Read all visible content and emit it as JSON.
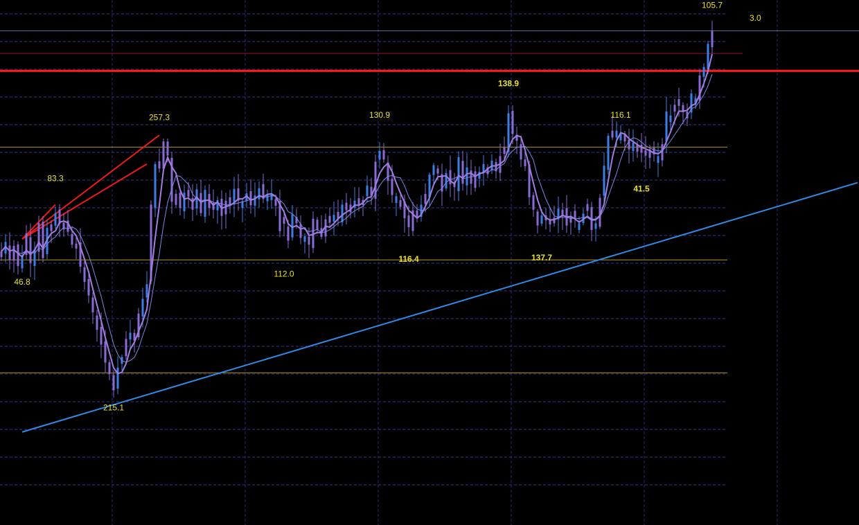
{
  "colors": {
    "background": "#000000",
    "grid_dash": "#3a3a9a",
    "grid_vertical": "#2a2a7a",
    "level_yellow": "#b8961e",
    "level_red_thick": "#ff1a1a",
    "level_maroon": "#8a1a2a",
    "level_steel": "#5a6a9a",
    "candle_blue": "#3b7fe6",
    "candle_violet": "#8a6ad6",
    "ma_short": "#a27ee0",
    "ma_long": "#7c8ae8",
    "trend_blue": "#2e8be8",
    "trend_red": "#ee1a1a",
    "label_yellow": "#e8e030"
  },
  "chart_data": {
    "type": "candlestick",
    "title": "",
    "xlabel": "",
    "ylabel": "",
    "bar_count": 175,
    "annotations": [
      {
        "text": "105.7",
        "bar": 171,
        "price": 105.7,
        "style": "normal",
        "pos": "above"
      },
      {
        "text": "3.0",
        "bar": 180,
        "price": 104.9,
        "style": "normal",
        "pos": "right"
      },
      {
        "text": "138.9",
        "bar": 122,
        "price": 91.8,
        "style": "bold",
        "pos": "above"
      },
      {
        "text": "257.3",
        "bar": 38,
        "price": 85.8,
        "style": "normal",
        "pos": "above"
      },
      {
        "text": "130.9",
        "bar": 91,
        "price": 86.2,
        "style": "normal",
        "pos": "above"
      },
      {
        "text": "116.1",
        "bar": 149,
        "price": 86.2,
        "style": "normal",
        "pos": "above"
      },
      {
        "text": "83.3",
        "bar": 13,
        "price": 75.0,
        "style": "normal",
        "pos": "above"
      },
      {
        "text": "41.5",
        "bar": 154,
        "price": 76.1,
        "style": "bold",
        "pos": "below"
      },
      {
        "text": "116.4",
        "bar": 98,
        "price": 63.6,
        "style": "bold",
        "pos": "below"
      },
      {
        "text": "137.7",
        "bar": 130,
        "price": 63.9,
        "style": "bold",
        "pos": "below"
      },
      {
        "text": "112.0",
        "bar": 68,
        "price": 61.0,
        "style": "normal",
        "pos": "below"
      },
      {
        "text": "46.8",
        "bar": 5,
        "price": 59.6,
        "style": "normal",
        "pos": "below"
      },
      {
        "text": "215.1",
        "bar": 27,
        "price": 37.3,
        "style": "normal",
        "pos": "below"
      }
    ],
    "levels": [
      {
        "name": "steel",
        "price": 102.6
      },
      {
        "name": "maroon",
        "price": 98.6
      },
      {
        "name": "red-thick",
        "price": 95.5
      },
      {
        "name": "yellow-upper",
        "price": 82.0
      },
      {
        "name": "yellow-middle",
        "price": 62.0
      },
      {
        "name": "yellow-lower",
        "price": 42.0
      }
    ],
    "trendlines": [
      {
        "name": "support",
        "color": "blue",
        "from": {
          "bar": 5,
          "price": 31.5
        },
        "to": {
          "bar": 206,
          "price": 75.7
        }
      },
      {
        "name": "fan-upper",
        "color": "red",
        "from": {
          "bar": 5,
          "price": 65.7
        },
        "to": {
          "bar": 38,
          "price": 84.1
        }
      },
      {
        "name": "fan-middle",
        "color": "red",
        "from": {
          "bar": 5,
          "price": 65.7
        },
        "to": {
          "bar": 13,
          "price": 71.8
        }
      },
      {
        "name": "fan-lower",
        "color": "red",
        "from": {
          "bar": 5,
          "price": 65.7
        },
        "to": {
          "bar": 35,
          "price": 79.0
        }
      }
    ],
    "closes": [
      63.5,
      65.2,
      62.0,
      64.5,
      60.9,
      62.8,
      66.7,
      61.5,
      63.9,
      68.5,
      62.3,
      67.7,
      68.3,
      70.3,
      68.4,
      68.6,
      67.0,
      64.7,
      64.9,
      60.8,
      58.1,
      55.7,
      52.7,
      49.6,
      47.0,
      43.8,
      41.8,
      38.9,
      42.9,
      44.8,
      48.0,
      49.1,
      47.7,
      52.5,
      55.1,
      57.7,
      71.8,
      79.0,
      78.2,
      83.0,
      80.5,
      72.3,
      73.7,
      71.2,
      73.9,
      73.2,
      70.9,
      74.5,
      70.3,
      74.4,
      71.2,
      70.9,
      72.6,
      69.8,
      72.5,
      71.7,
      74.6,
      72.5,
      72.4,
      73.8,
      71.7,
      73.4,
      74.7,
      72.8,
      73.6,
      73.8,
      72.8,
      67.1,
      68.4,
      65.4,
      70.1,
      68.5,
      65.9,
      66.2,
      64.7,
      69.3,
      67.3,
      66.1,
      69.2,
      68.6,
      70.0,
      69.3,
      71.8,
      70.8,
      71.8,
      72.5,
      71.6,
      72.6,
      75.2,
      73.4,
      79.4,
      81.3,
      79.8,
      76.0,
      73.5,
      73.3,
      72.6,
      69.4,
      67.8,
      70.8,
      69.6,
      71.8,
      73.7,
      77.1,
      78.8,
      77.3,
      74.1,
      77.4,
      75.4,
      74.9,
      80.2,
      75.5,
      78.4,
      75.5,
      77.7,
      77.6,
      79.0,
      78.4,
      79.6,
      77.7,
      80.4,
      80.8,
      88.0,
      84.3,
      83.1,
      79.8,
      78.6,
      73.1,
      70.9,
      68.1,
      69.9,
      69.0,
      69.2,
      68.5,
      71.1,
      70.9,
      68.1,
      68.6,
      69.5,
      68.5,
      70.2,
      70.7,
      67.3,
      68.5,
      73.0,
      78.7,
      84.0,
      84.9,
      84.9,
      84.4,
      83.0,
      81.6,
      82.8,
      82.4,
      81.0,
      80.5,
      81.6,
      80.7,
      80.4,
      82.5,
      88.3,
      87.6,
      88.3,
      89.3,
      88.2,
      88.3,
      91.5,
      90.7,
      94.7,
      96.2,
      100.3,
      102.7
    ]
  }
}
